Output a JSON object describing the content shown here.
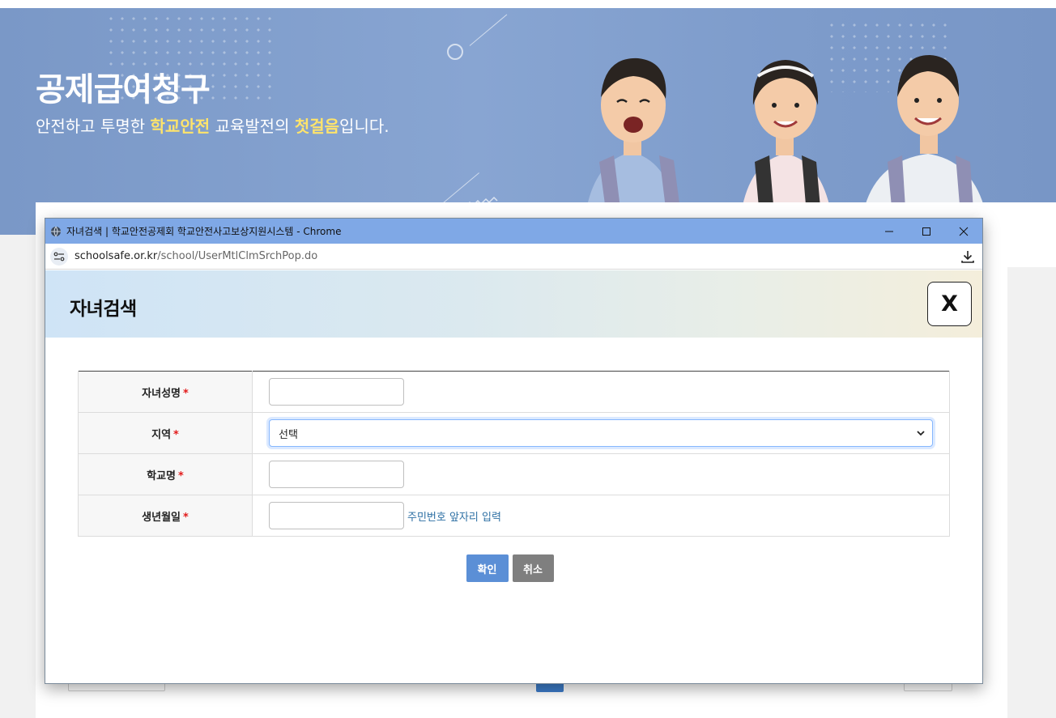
{
  "banner": {
    "title": "공제급여청구",
    "subtitle_part1": "안전하고 투명한 ",
    "subtitle_hl1": "학교안전",
    "subtitle_part2": " 교육발전의 ",
    "subtitle_hl2": "첫걸음",
    "subtitle_part3": "입니다."
  },
  "window": {
    "title": "자녀검색 | 학교안전공제회 학교안전사고보상지원시스템 - Chrome",
    "url_domain": "schoolsafe.or.kr",
    "url_path": "/school/UserMtlClmSrchPop.do"
  },
  "popup": {
    "title": "자녀검색",
    "close_label": "X"
  },
  "form": {
    "child_name_label": "자녀성명",
    "region_label": "지역",
    "region_selected": "선택",
    "school_label": "학교명",
    "birth_label": "생년월일",
    "birth_hint": "주민번호 앞자리 입력",
    "required_mark": "*"
  },
  "buttons": {
    "confirm": "확인",
    "cancel": "취소"
  },
  "colors": {
    "banner": "#7a98c7",
    "titlebar": "#7fa8e6",
    "confirm": "#5b8fd6",
    "cancel": "#7f7f7f",
    "required": "#e21b1b",
    "hint": "#2d6fa3"
  }
}
